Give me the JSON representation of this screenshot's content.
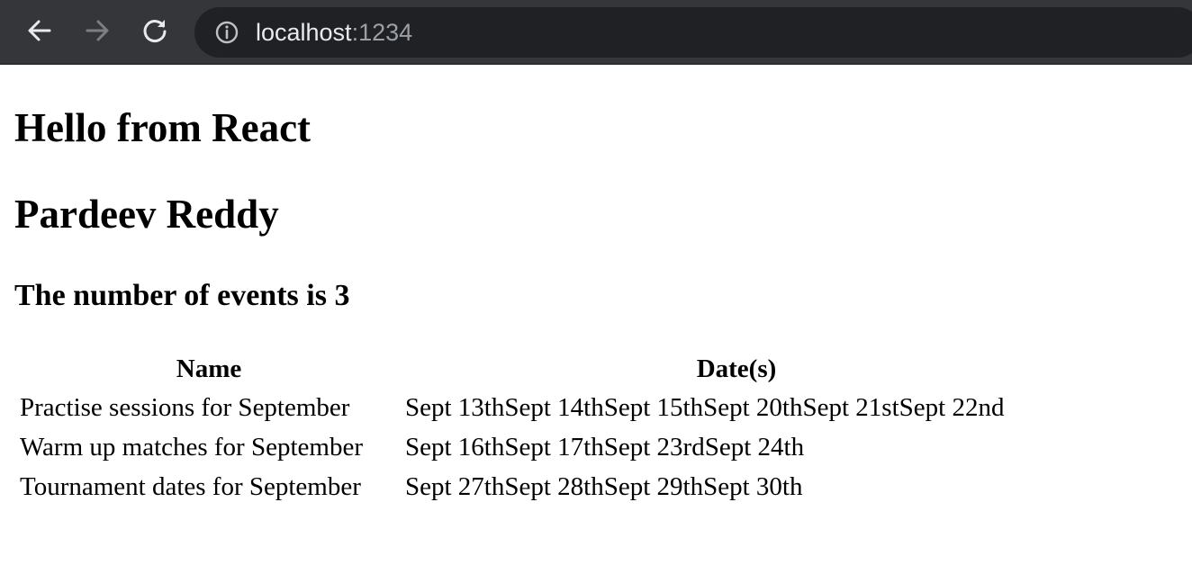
{
  "browser": {
    "url_host": "localhost",
    "url_port": ":1234"
  },
  "page": {
    "heading_hello": "Hello from React",
    "heading_name": "Pardeev Reddy",
    "heading_count": "The number of events is 3"
  },
  "table": {
    "headers": [
      "Name",
      "Date(s)"
    ],
    "rows": [
      {
        "name": "Practise sessions for September",
        "dates": [
          "Sept 13th",
          "Sept 14th",
          "Sept 15th",
          "Sept 20th",
          "Sept 21st",
          "Sept 22nd"
        ]
      },
      {
        "name": "Warm up matches for September",
        "dates": [
          "Sept 16th",
          "Sept 17th",
          "Sept 23rd",
          "Sept 24th"
        ]
      },
      {
        "name": "Tournament dates for September",
        "dates": [
          "Sept 27th",
          "Sept 28th",
          "Sept 29th",
          "Sept 30th"
        ]
      }
    ]
  },
  "icons": {
    "back": "arrow-left-icon",
    "forward": "arrow-right-icon",
    "reload": "reload-icon",
    "site_info": "info-icon"
  },
  "colors": {
    "toolbar_bg": "#35363a",
    "omnibox_bg": "#202124",
    "url_host": "#e8eaed",
    "url_port": "#9aa0a6",
    "forward_disabled": "#7b7e82"
  }
}
